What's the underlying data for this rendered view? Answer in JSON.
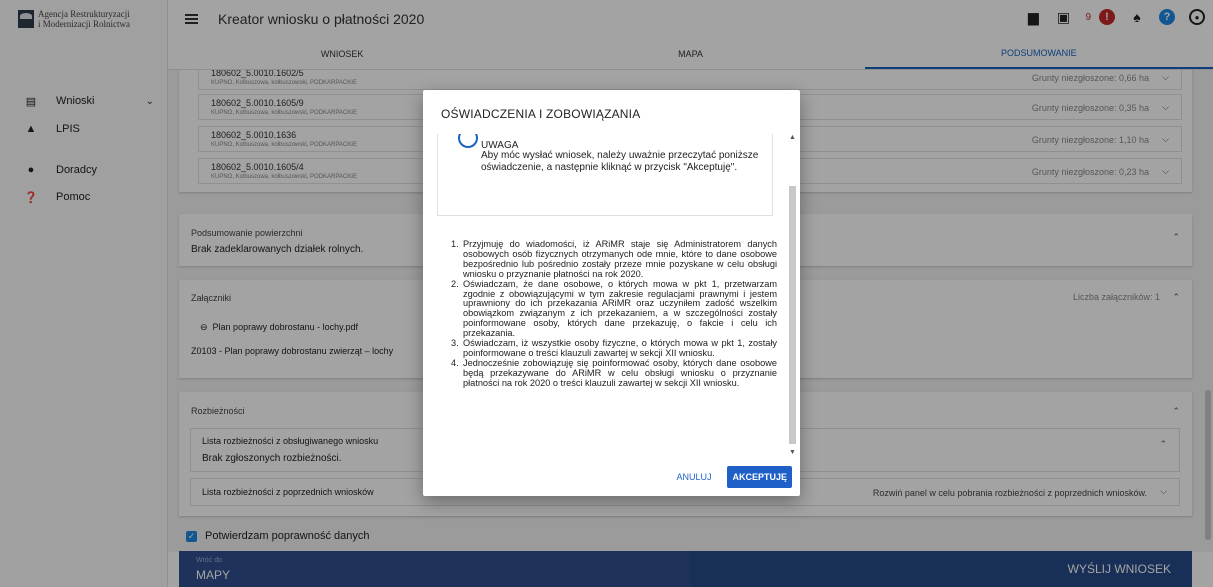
{
  "logo": {
    "line1": "Agencja Restrukturyzacji",
    "line2": "i Modernizacji Rolnictwa"
  },
  "sidebar": {
    "items": [
      {
        "label": "Wnioski",
        "icon": "clipboard-icon"
      },
      {
        "label": "LPIS",
        "icon": "mountain-icon"
      },
      {
        "label": "Doradcy",
        "icon": "person-icon"
      },
      {
        "label": "Pomoc",
        "icon": "help-icon"
      }
    ]
  },
  "header": {
    "title": "Kreator wniosku o płatności 2020",
    "notification_count": "9"
  },
  "tabs": [
    "WNIOSEK",
    "MAPA",
    "PODSUMOWANIE"
  ],
  "plots": [
    {
      "id": "180602_5.0010.1602/5",
      "location": "KUPNO, Kolbuszowa, kolbuszowski, PODKARPACKIE",
      "area": "Grunty niezgłoszone: 0,66 ha"
    },
    {
      "id": "180602_5.0010.1605/9",
      "location": "KUPNO, Kolbuszowa, kolbuszowski, PODKARPACKIE",
      "area": "Grunty niezgłoszone: 0,35 ha"
    },
    {
      "id": "180602_5.0010.1636",
      "location": "KUPNO, Kolbuszowa, kolbuszowski, PODKARPACKIE",
      "area": "Grunty niezgłoszone: 1,10 ha"
    },
    {
      "id": "180602_5.0010.1605/4",
      "location": "KUPNO, Kolbuszowa, kolbuszowski, PODKARPACKIE",
      "area": "Grunty niezgłoszone: 0,23 ha"
    }
  ],
  "summary": {
    "title": "Podsumowanie powierzchni",
    "text": "Brak zadeklarowanych działek rolnych."
  },
  "attachments": {
    "title": "Załączniki",
    "count_label": "Liczba załączników: 1",
    "file": "Plan poprawy dobrostanu - lochy.pdf",
    "type": "Z0103 - Plan poprawy dobrostanu zwierząt – lochy"
  },
  "discrepancies": {
    "title": "Rozbieżności",
    "current_title": "Lista rozbieżności z obsługiwanego wniosku",
    "current_text": "Brak zgłoszonych rozbieżności.",
    "previous_title": "Lista rozbieżności z poprzednich wniosków",
    "previous_hint": "Rozwiń panel w celu pobrania rozbieżności z poprzednich wniosków."
  },
  "confirm_label": "Potwierdzam poprawność danych",
  "bottom": {
    "back_small": "Wróć do",
    "back_big": "MAPY",
    "send": "WYŚLIJ WNIOSEK"
  },
  "modal": {
    "title": "OŚWIADCZENIA I ZOBOWIĄZANIA",
    "warning_title": "UWAGA",
    "warning_text": "Aby móc wysłać wniosek, należy uważnie przeczytać poniższe oświadczenie, a następnie kliknąć w przycisk \"Akceptuję\".",
    "terms": [
      {
        "num": "1.",
        "text": "Przyjmuję do wiadomości, iż ARiMR staje się Administratorem danych osobowych osób fizycznych otrzymanych ode mnie, które to dane osobowe bezpośrednio lub pośrednio zostały przeze mnie pozyskane w celu obsługi wniosku o przyznanie płatności na rok 2020."
      },
      {
        "num": "2.",
        "text": "Oświadczam, że dane osobowe, o których mowa w pkt 1, przetwarzam zgodnie z obowiązującymi w tym zakresie regulacjami prawnymi i jestem uprawniony do ich przekazania ARiMR oraz uczyniłem zadość wszelkim obowiązkom związanym z ich przekazaniem, a w szczególności zostały poinformowane osoby, których dane przekazuję, o fakcie i celu ich przekazania."
      },
      {
        "num": "3.",
        "text": "Oświadczam, iż wszystkie osoby fizyczne, o których mowa w pkt 1, zostały poinformowane o treści klauzuli zawartej w sekcji XII wniosku."
      },
      {
        "num": "4.",
        "text": "Jednocześnie zobowiązuję się poinformować osoby, których dane osobowe będą przekazywane do ARiMR w celu obsługi wniosku o przyznanie płatności na rok 2020 o treści klauzuli zawartej w sekcji XII wniosku."
      }
    ],
    "cancel": "ANULUJ",
    "accept": "AKCEPTUJĘ"
  },
  "colors": {
    "accent": "#1565c0",
    "bottom_bar": "#2f4f8f",
    "alert": "#c62828"
  }
}
